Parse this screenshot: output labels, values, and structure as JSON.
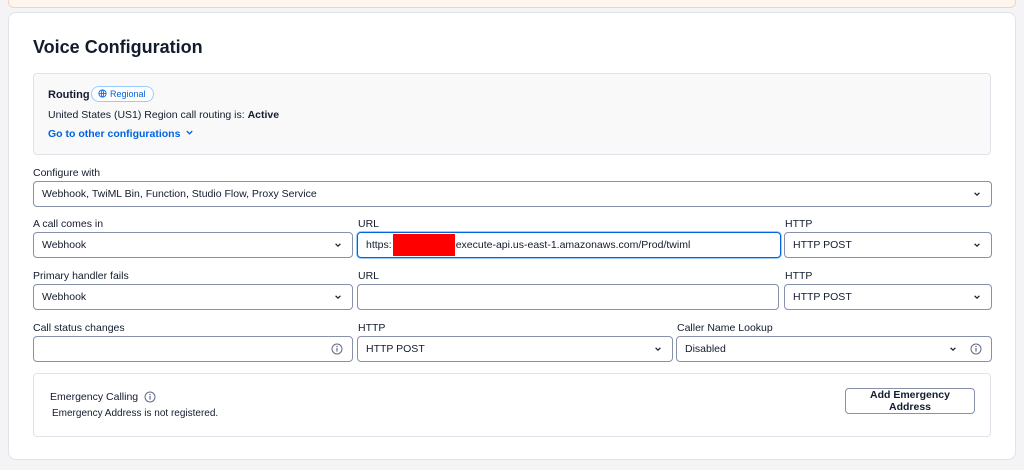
{
  "page": {
    "title": "Voice Configuration"
  },
  "routing": {
    "title": "Routing",
    "badge": "Regional",
    "status_prefix": "United States (US1) Region call routing is: ",
    "status_value": "Active",
    "link": "Go to other configurations"
  },
  "configure_with": {
    "label": "Configure with",
    "value": "Webhook, TwiML Bin, Function, Studio Flow, Proxy Service"
  },
  "incoming": {
    "label": "A call comes in",
    "type_value": "Webhook",
    "url_label": "URL",
    "url_prefix": "https:",
    "url_suffix": "execute-api.us-east-1.amazonaws.com/Prod/twiml",
    "http_label": "HTTP",
    "http_value": "HTTP POST"
  },
  "fallback": {
    "label": "Primary handler fails",
    "type_value": "Webhook",
    "url_label": "URL",
    "url_value": "",
    "http_label": "HTTP",
    "http_value": "HTTP POST"
  },
  "status_callback": {
    "label": "Call status changes",
    "value": "",
    "http_label": "HTTP",
    "http_value": "HTTP POST",
    "lookup_label": "Caller Name Lookup",
    "lookup_value": "Disabled"
  },
  "emergency": {
    "title": "Emergency Calling",
    "status": "Emergency Address is not registered.",
    "button": "Add Emergency Address"
  },
  "colors": {
    "accent": "#0263e0",
    "border": "#8891aa",
    "redaction": "#ff0000"
  },
  "icons": {
    "chevron": "chevron-down-icon",
    "info": "info-icon",
    "globe": "globe-icon"
  }
}
